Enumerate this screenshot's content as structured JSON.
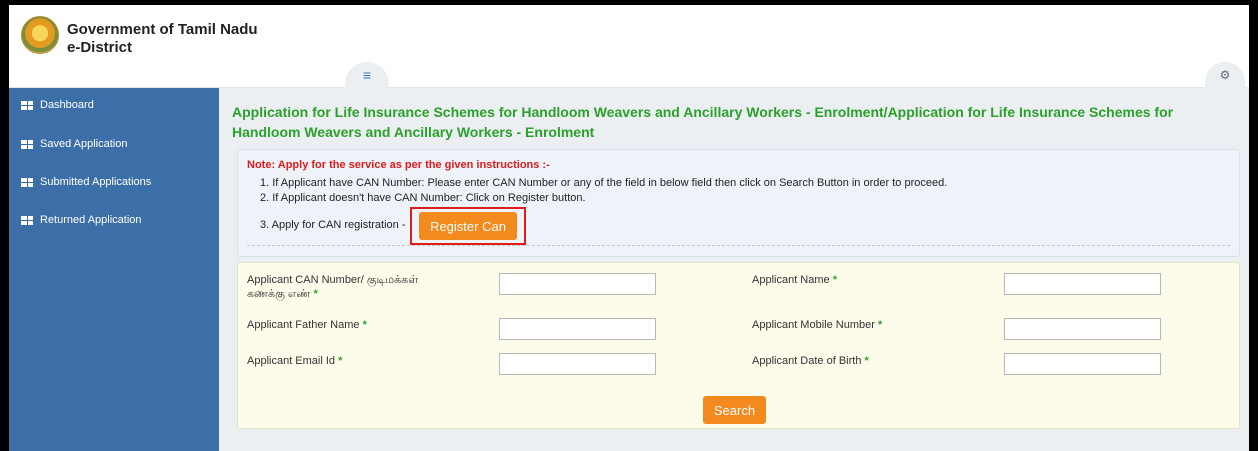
{
  "header": {
    "brand_line1": "Government of Tamil Nadu",
    "brand_line2": "e-District",
    "menu_icon": "hamburger-icon",
    "settings_icon": "gears-icon"
  },
  "sidebar": {
    "items": [
      {
        "label": "Dashboard",
        "icon": "grid-icon"
      },
      {
        "label": "Saved Application",
        "icon": "grid-icon"
      },
      {
        "label": "Submitted Applications",
        "icon": "grid-icon"
      },
      {
        "label": "Returned Application",
        "icon": "grid-icon"
      }
    ]
  },
  "main": {
    "title_line1": "Application for Life Insurance Schemes for Handloom Weavers and Ancillary Workers - Enrolment/Application for Life Insurance Schemes for",
    "title_line2": "Handloom Weavers and Ancillary Workers - Enrolment",
    "note": {
      "title": "Note: Apply for the service as per the given instructions :-",
      "line1": "1. If Applicant have CAN Number: Please enter CAN Number or any of the field in below field then click on Search Button in order to proceed.",
      "line2": "2. If Applicant doesn't have CAN Number: Click on Register button.",
      "line3": "3. Apply for CAN registration -",
      "register_label": "Register Can"
    },
    "form": {
      "can_label_1": "Applicant CAN Number/ குடிமக்கள்",
      "can_label_2": "கணக்கு எண்",
      "name_label": "Applicant Name",
      "father_label": "Applicant Father Name",
      "mobile_label": "Applicant Mobile Number",
      "email_label": "Applicant Email Id",
      "dob_label": "Applicant Date of Birth",
      "required_mark": "*",
      "search_label": "Search"
    }
  },
  "colors": {
    "sidebar_bg": "#3c6fa7",
    "title_green": "#2aa12a",
    "button_orange": "#f28a1e",
    "note_red": "#e11b1b"
  }
}
